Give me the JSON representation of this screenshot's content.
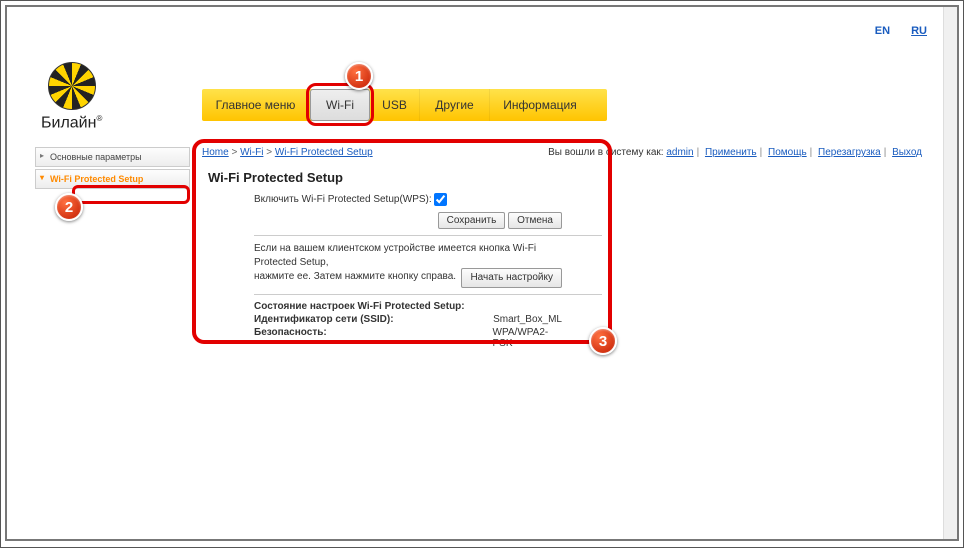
{
  "lang": {
    "en": "EN",
    "ru": "RU"
  },
  "logo": {
    "text": "Билайн"
  },
  "nav": {
    "main": "Главное меню",
    "wifi": "Wi-Fi",
    "usb": "USB",
    "other": "Другие",
    "info": "Информация"
  },
  "sidebar": {
    "basic": "Основные параметры",
    "wps": "Wi-Fi Protected Setup"
  },
  "crumbs": {
    "home": "Home",
    "wifi": "Wi-Fi",
    "wps": "Wi-Fi Protected Setup"
  },
  "userbar": {
    "logged_as": "Вы вошли в систему как:",
    "admin": "admin",
    "apply": "Применить",
    "help": "Помощь",
    "reboot": "Перезагрузка",
    "logout": "Выход"
  },
  "title": "Wi-Fi Protected Setup",
  "form": {
    "enable_label": "Включить Wi-Fi Protected Setup(WPS):",
    "save": "Сохранить",
    "cancel": "Отмена",
    "note1": "Если на вашем клиентском устройстве имеется кнопка Wi-Fi Protected Setup,",
    "note2": "нажмите ее. Затем нажмите кнопку справа.",
    "start": "Начать настройку"
  },
  "status": {
    "heading": "Состояние настроек Wi-Fi Protected Setup:",
    "ssid_label": "Идентификатор сети (SSID):",
    "ssid_value": "Smart_Box_ML",
    "sec_label": "Безопасность:",
    "sec_value": "WPA/WPA2-PSK"
  },
  "markers": {
    "m1": "1",
    "m2": "2",
    "m3": "3"
  }
}
